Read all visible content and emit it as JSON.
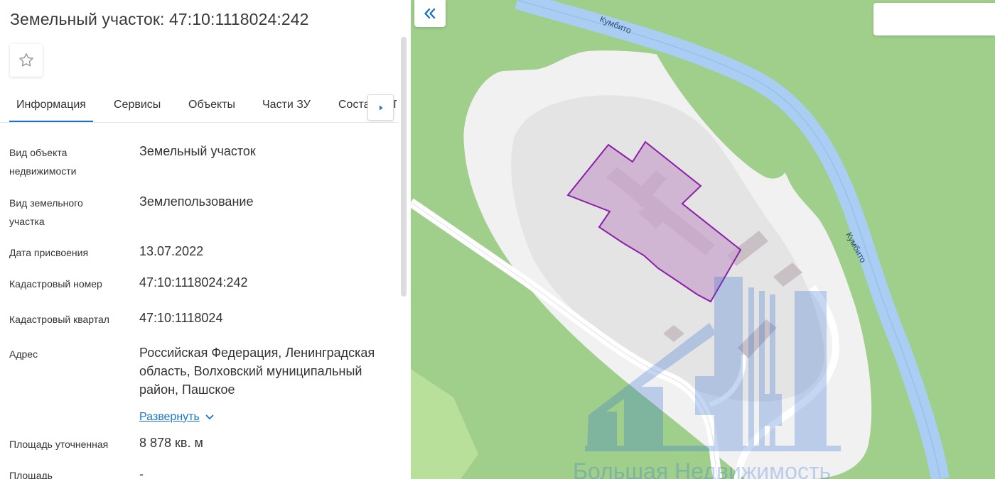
{
  "header": {
    "title": "Земельный участок: 47:10:1118024:242"
  },
  "tabs": [
    {
      "label": "Информация"
    },
    {
      "label": "Сервисы"
    },
    {
      "label": "Объекты"
    },
    {
      "label": "Части ЗУ"
    },
    {
      "label": "Состав ЕЗП"
    }
  ],
  "info": {
    "rows": [
      {
        "label": "Вид объекта недвижимости",
        "value": "Земельный участок"
      },
      {
        "label": "Вид земельного участка",
        "value": "Землепользование"
      },
      {
        "label": "Дата присвоения",
        "value": "13.07.2022"
      },
      {
        "label": "Кадастровый номер",
        "value": "47:10:1118024:242"
      },
      {
        "label": "Кадастровый квартал",
        "value": "47:10:1118024"
      },
      {
        "label": "Адрес",
        "value": "Российская Федерация, Ленинградская область, Волховский муниципальный район, Пашское"
      },
      {
        "label": "Площадь уточненная",
        "value": "8 878 кв. м"
      },
      {
        "label": "Площадь",
        "value": "-"
      }
    ],
    "expand_label": "Развернуть"
  },
  "map": {
    "river_label_top": "Кумбито",
    "river_label_right": "Кумбито",
    "watermark": "Большая Недвижимость",
    "parcel_color": "#8b1fa9",
    "search_placeholder": ""
  },
  "icons": {
    "favorite": "star-outline-icon",
    "tab_next": "caret-right-icon",
    "collapse": "double-chevron-left-icon",
    "expand": "chevron-down-icon"
  }
}
